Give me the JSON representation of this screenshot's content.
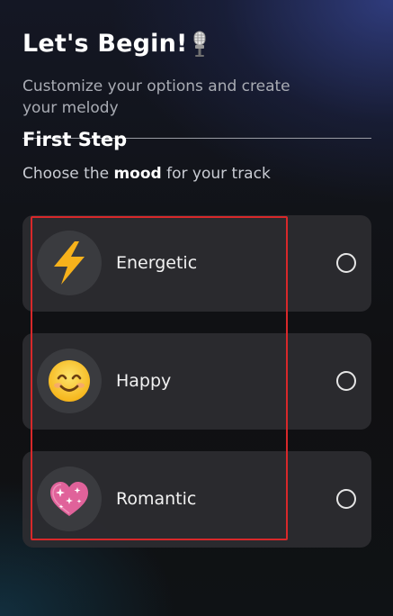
{
  "header": {
    "title": "Let's Begin!",
    "title_icon": "microphone-icon",
    "subtitle": "Customize your options and create your melody"
  },
  "step": {
    "title": "First Step",
    "instruction_prefix": "Choose the ",
    "instruction_bold": "mood",
    "instruction_suffix": " for your track"
  },
  "moods": [
    {
      "label": "Energetic",
      "icon": "lightning-bolt-icon",
      "selected": false
    },
    {
      "label": "Happy",
      "icon": "smiling-face-icon",
      "selected": false
    },
    {
      "label": "Romantic",
      "icon": "sparkling-heart-icon",
      "selected": false
    }
  ],
  "colors": {
    "accent_highlight": "#d8282a",
    "card_background": "#2c2d31",
    "icon_circle": "#3a3b3f",
    "bolt": "#f7b21b",
    "smiley": "#fbc02d",
    "heart": "#e0629a"
  }
}
